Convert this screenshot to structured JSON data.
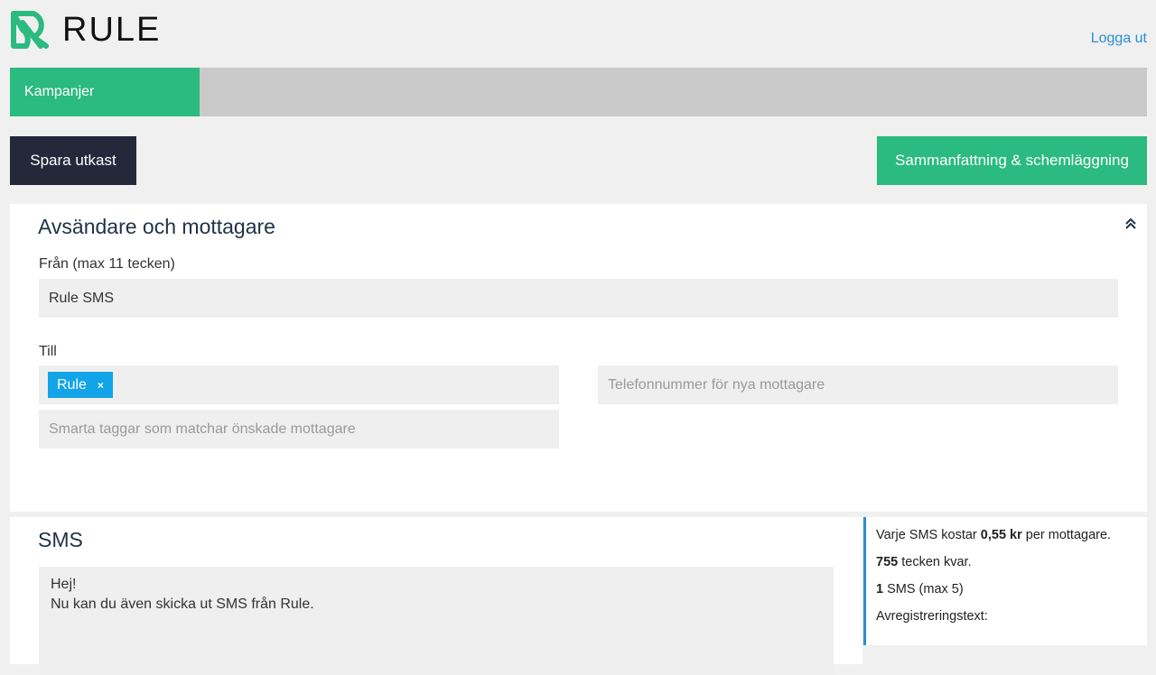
{
  "header": {
    "logo_text": "RULE",
    "logout_label": "Logga ut",
    "brand_color": "#2bba7f"
  },
  "nav": {
    "tabs": [
      {
        "label": "Kampanjer",
        "active": true
      }
    ]
  },
  "toolbar": {
    "save_draft_label": "Spara utkast",
    "summary_label": "Sammanfattning & schemläggning"
  },
  "sender_panel": {
    "title": "Avsändare och mottagare",
    "from_label": "Från (max 11 tecken)",
    "from_value": "Rule SMS",
    "to_label": "Till",
    "tags": [
      {
        "label": "Rule",
        "remove": "×"
      }
    ],
    "smart_tags_placeholder": "Smarta taggar som matchar önskade mottagare",
    "phone_placeholder": "Telefonnummer för nya mottagare"
  },
  "sms_panel": {
    "title": "SMS",
    "message": "Hej!\nNu kan du även skicka ut SMS från Rule."
  },
  "info": {
    "cost_prefix": "Varje SMS kostar ",
    "cost_value": "0,55 kr",
    "cost_suffix": " per mottagare.",
    "chars_left_value": "755",
    "chars_left_suffix": " tecken kvar.",
    "sms_count_value": "1",
    "sms_count_suffix": " SMS (max 5)",
    "unsubscribe_label": "Avregistreringstext:"
  }
}
